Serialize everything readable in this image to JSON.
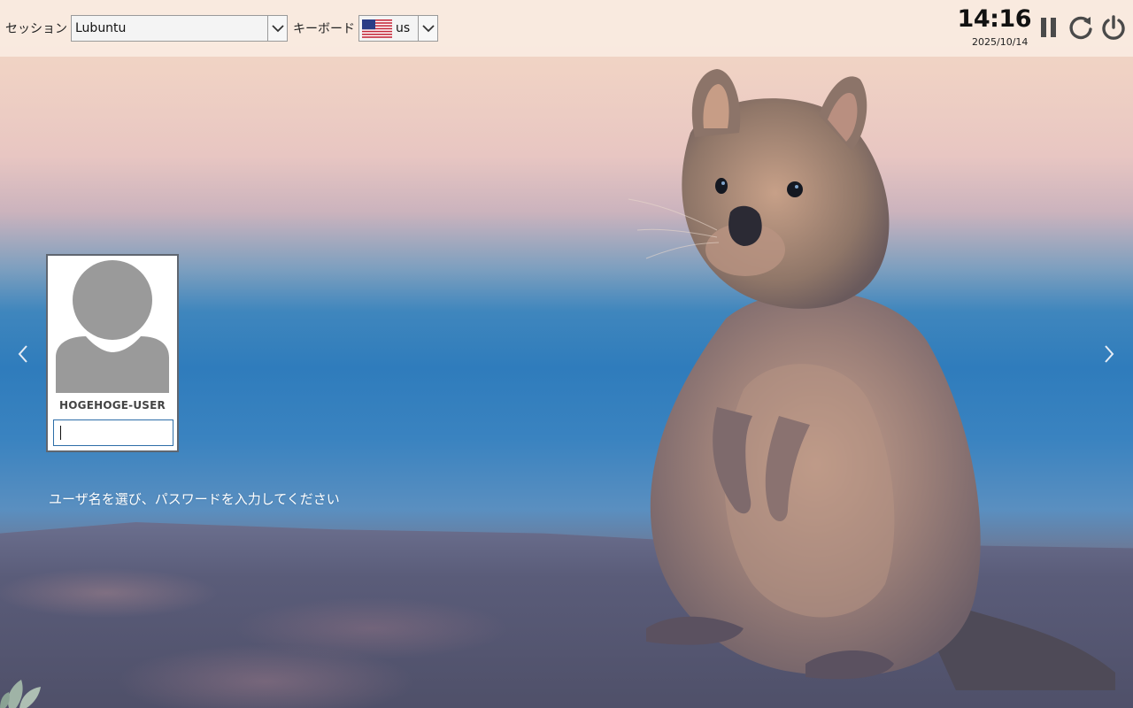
{
  "topbar": {
    "session_label": "セッション",
    "session_value": "Lubuntu",
    "keyboard_label": "キーボード",
    "keyboard_value": "us",
    "keyboard_flag_icon": "us-flag-icon",
    "time": "14:16",
    "date": "2025/10/14",
    "suspend_icon": "pause-icon",
    "restart_icon": "restart-icon",
    "power_icon": "power-icon"
  },
  "login": {
    "username": "HOGEHOGE-USER",
    "password_value": "",
    "avatar_icon": "user-avatar-icon",
    "prompt": "ユーザ名を選び、パスワードを入力してください"
  },
  "nav": {
    "prev_icon": "chevron-left-icon",
    "next_icon": "chevron-right-icon"
  },
  "colors": {
    "topbar_bg": "#f9eee4",
    "card_border": "#5f6670",
    "input_border": "#2d6ea8",
    "avatar_gray": "#9a9a9a"
  }
}
